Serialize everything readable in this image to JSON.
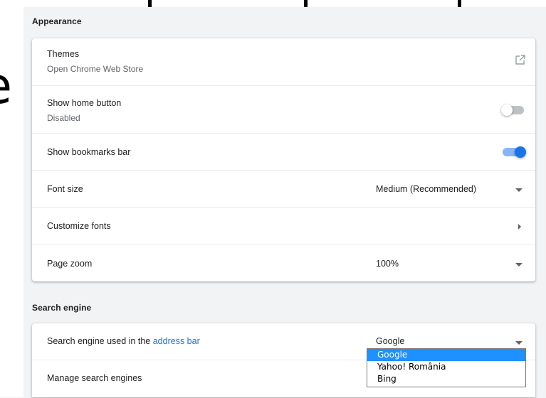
{
  "appearance": {
    "section_title": "Appearance",
    "themes": {
      "label": "Themes",
      "sublabel": "Open Chrome Web Store",
      "icon": "open-in-new-icon"
    },
    "home_button": {
      "label": "Show home button",
      "sublabel": "Disabled",
      "enabled": false
    },
    "bookmarks_bar": {
      "label": "Show bookmarks bar",
      "enabled": true
    },
    "font_size": {
      "label": "Font size",
      "value": "Medium (Recommended)"
    },
    "customize_fonts": {
      "label": "Customize fonts"
    },
    "page_zoom": {
      "label": "Page zoom",
      "value": "100%"
    }
  },
  "search_engine": {
    "section_title": "Search engine",
    "used_label_prefix": "Search engine used in the ",
    "used_label_link": "address bar",
    "value": "Google",
    "manage_label": "Manage search engines",
    "options": [
      "Google",
      "Yahoo! România",
      "Bing"
    ],
    "selected_option": "Google"
  },
  "background_fragment": {
    "letter": "e"
  },
  "colors": {
    "accent": "#1a73e8",
    "toggle_off_track": "#bdc1c6",
    "toggle_off_knob": "#ffffff",
    "toggle_on_track": "#8ab4f8",
    "toggle_on_knob": "#1a73e8",
    "dropdown_highlight": "#1e90ff"
  }
}
